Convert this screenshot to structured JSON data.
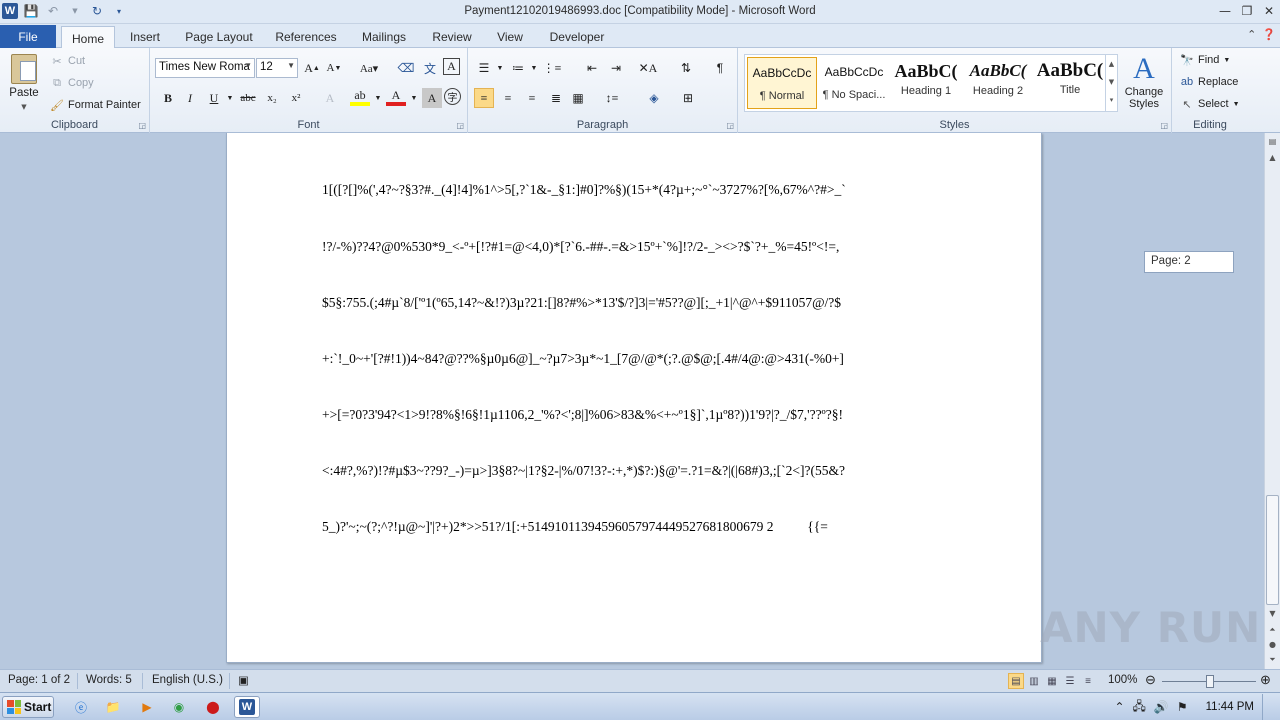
{
  "window": {
    "title": "Payment12102019486993.doc [Compatibility Mode]  -  Microsoft Word"
  },
  "tabs": [
    "Home",
    "Insert",
    "Page Layout",
    "References",
    "Mailings",
    "Review",
    "View",
    "Developer"
  ],
  "file_tab": "File",
  "active_tab": "Home",
  "clipboard": {
    "paste": "Paste",
    "cut": "Cut",
    "copy": "Copy",
    "format_painter": "Format Painter",
    "label": "Clipboard"
  },
  "font": {
    "name": "Times New Roma",
    "size": "12",
    "label": "Font"
  },
  "paragraph": {
    "label": "Paragraph"
  },
  "styles": {
    "items": [
      {
        "sample": "AaBbCcDc",
        "name": "¶ Normal"
      },
      {
        "sample": "AaBbCcDc",
        "name": "¶ No Spaci..."
      },
      {
        "sample": "AaBbC(",
        "name": "Heading 1"
      },
      {
        "sample": "AaBbC(",
        "name": "Heading 2"
      },
      {
        "sample": "AaBbC(",
        "name": "Title"
      }
    ],
    "change_styles": "Change Styles",
    "label": "Styles"
  },
  "editing": {
    "find": "Find",
    "replace": "Replace",
    "select": "Select",
    "label": "Editing"
  },
  "document": {
    "lines": [
      "1[([?[]%(',4?~?§3?#._(4]!4]%1^>5[,?`1&-_§1:]#0]?%§)(15+*(4?µ+;~°`~3727%?[%,67%^?#>_`",
      "!?/-%)??4?@0%530*9_<-º+[!?#1=@<4,0)*[?`6.-##-.=&>15º+`%]!?/2-_><>?$`?+_%=45!º<!=,",
      "$5§:755.(;4#µ`8/['º1(º65,14?~&!?)3µ?21:[]8?#%>*13'$/?]3|='#5??@][;_+1|^@^+$911057@/?$",
      "+:`!_0~+'[?#!1))4~84?@??%§µ0µ6@]_~?µ7>3µ*~1_[7@/@*(;?.@$@;[.4#/4@:@>431(-%0+]",
      "+>[=?0?3'94?<1>9!?8%§!6§!1µ1106,2_'%?<';8|]%06>83&%<+~º1§]`,1µº8?))1'9?|?_/$7,'??º?§!",
      "<:4#?,%?)!?#µ$3~??9?_-)=µ>]3§8?~|1?§2-|%/07!3?-:+,*)$?:)§@'=.?1=&?|(|68#)3,;[`2<]?(55&?",
      "5_)?'~;~(?;^?!µ@~]'|?+)2*>>51?/1[:+51491011394596057974449527681800679 2          {{="
    ]
  },
  "page_tooltip": "Page: 2",
  "watermark": "ANY RUN",
  "status": {
    "page": "Page: 1 of 2",
    "words": "Words: 5",
    "language": "English (U.S.)",
    "zoom": "100%"
  },
  "taskbar": {
    "start": "Start",
    "clock": "11:44 PM"
  }
}
